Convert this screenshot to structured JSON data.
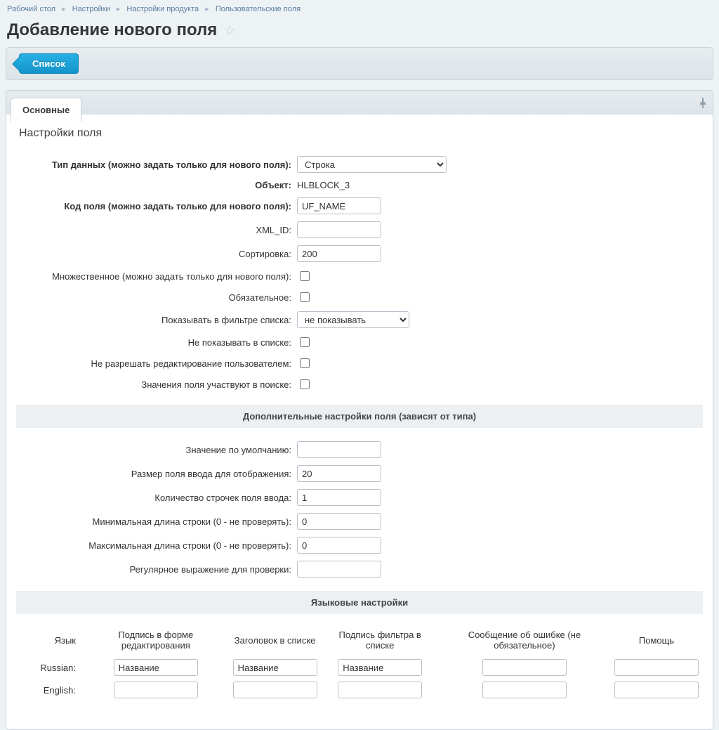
{
  "breadcrumb": {
    "items": [
      "Рабочий стол",
      "Настройки",
      "Настройки продукта",
      "Пользовательские поля"
    ]
  },
  "page": {
    "title": "Добавление нового поля",
    "list_button": "Список",
    "tab_main": "Основные",
    "section_title": "Настройки поля"
  },
  "labels": {
    "data_type": "Тип данных (можно задать только для нового поля):",
    "object": "Объект:",
    "field_code": "Код поля (можно задать только для нового поля):",
    "xml_id": "XML_ID:",
    "sort": "Сортировка:",
    "multiple": "Множественное (можно задать только для нового поля):",
    "required": "Обязательное:",
    "filter": "Показывать в фильтре списка:",
    "no_list": "Не показывать в списке:",
    "no_edit": "Не разрешать редактирование пользователем:",
    "searchable": "Значения поля участвуют в поиске:",
    "extra_band": "Дополнительные настройки поля (зависят от типа)",
    "default": "Значение по умолчанию:",
    "size": "Размер поля ввода для отображения:",
    "rows": "Количество строчек поля ввода:",
    "min_len": "Минимальная длина строки (0 - не проверять):",
    "max_len": "Максимальная длина строки (0 - не проверять):",
    "regex": "Регулярное выражение для проверки:",
    "lang_band": "Языковые настройки"
  },
  "values": {
    "data_type": "Строка",
    "object": "HLBLOCK_3",
    "field_code": "UF_NAME",
    "xml_id": "",
    "sort": "200",
    "filter": "не показывать",
    "default": "",
    "size": "20",
    "rows": "1",
    "min_len": "0",
    "max_len": "0",
    "regex": ""
  },
  "lang_table": {
    "headers": {
      "lang": "Язык",
      "edit": "Подпись в форме редактирования",
      "list": "Заголовок в списке",
      "filter": "Подпись фильтра в списке",
      "error": "Сообщение об ошибке (не обязательное)",
      "help": "Помощь"
    },
    "rows": [
      {
        "lang": "Russian:",
        "edit": "Название",
        "list": "Название",
        "filter": "Название",
        "error": "",
        "help": ""
      },
      {
        "lang": "English:",
        "edit": "",
        "list": "",
        "filter": "",
        "error": "",
        "help": ""
      }
    ]
  }
}
